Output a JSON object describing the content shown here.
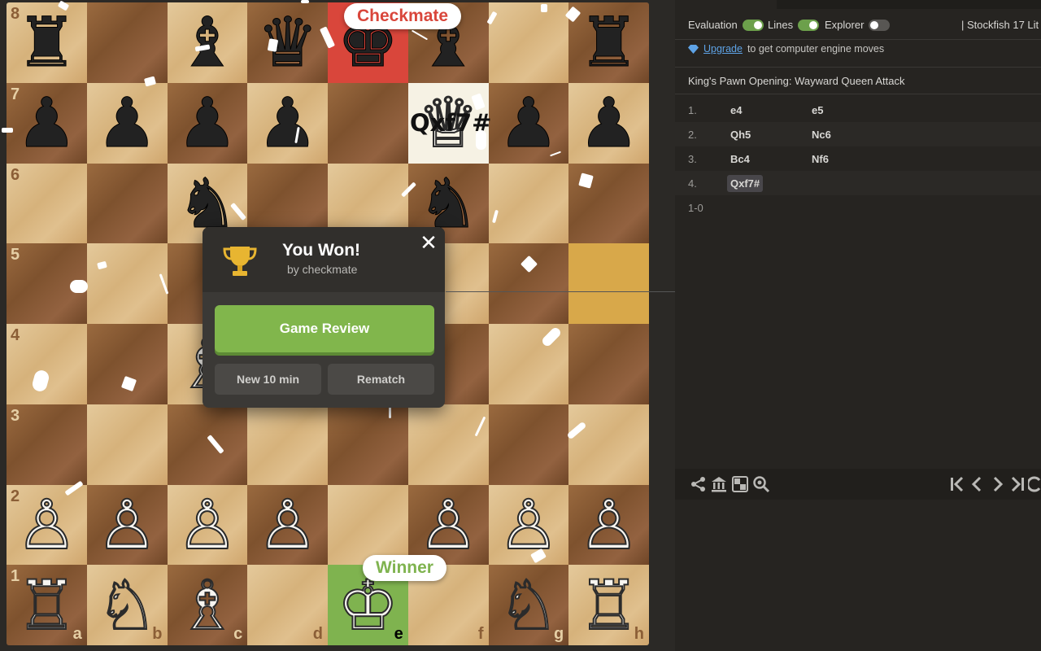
{
  "board": {
    "orientation": "white",
    "rows": [
      {
        "rank": "8",
        "squares": [
          {
            "file": "a",
            "piece": "♜",
            "color": "b",
            "shade": "light"
          },
          {
            "file": "b",
            "piece": "",
            "color": "",
            "shade": "dark"
          },
          {
            "file": "c",
            "piece": "♝",
            "color": "b",
            "shade": "light"
          },
          {
            "file": "d",
            "piece": "♛",
            "color": "b",
            "shade": "dark"
          },
          {
            "file": "e",
            "piece": "♚",
            "color": "b",
            "shade": "check"
          },
          {
            "file": "f",
            "piece": "♝",
            "color": "b",
            "shade": "dark"
          },
          {
            "file": "g",
            "piece": "",
            "color": "",
            "shade": "light"
          },
          {
            "file": "h",
            "piece": "♜",
            "color": "b",
            "shade": "dark"
          }
        ]
      },
      {
        "rank": "7",
        "squares": [
          {
            "file": "a",
            "piece": "♟",
            "color": "b",
            "shade": "dark"
          },
          {
            "file": "b",
            "piece": "♟",
            "color": "b",
            "shade": "light"
          },
          {
            "file": "c",
            "piece": "♟",
            "color": "b",
            "shade": "dark"
          },
          {
            "file": "d",
            "piece": "♟",
            "color": "b",
            "shade": "light"
          },
          {
            "file": "e",
            "piece": "",
            "color": "",
            "shade": "dark"
          },
          {
            "file": "f",
            "piece": "♕",
            "color": "w",
            "shade": "lastmove"
          },
          {
            "file": "g",
            "piece": "♟",
            "color": "b",
            "shade": "dark"
          },
          {
            "file": "h",
            "piece": "♟",
            "color": "b",
            "shade": "light"
          }
        ]
      },
      {
        "rank": "6",
        "squares": [
          {
            "file": "a",
            "piece": "",
            "color": "",
            "shade": "light"
          },
          {
            "file": "b",
            "piece": "",
            "color": "",
            "shade": "dark"
          },
          {
            "file": "c",
            "piece": "♞",
            "color": "b",
            "shade": "light"
          },
          {
            "file": "d",
            "piece": "",
            "color": "",
            "shade": "dark"
          },
          {
            "file": "e",
            "piece": "",
            "color": "",
            "shade": "light"
          },
          {
            "file": "f",
            "piece": "♞",
            "color": "b",
            "shade": "dark"
          },
          {
            "file": "g",
            "piece": "",
            "color": "",
            "shade": "light"
          },
          {
            "file": "h",
            "piece": "",
            "color": "",
            "shade": "dark"
          }
        ]
      },
      {
        "rank": "5",
        "squares": [
          {
            "file": "a",
            "piece": "",
            "color": "",
            "shade": "dark"
          },
          {
            "file": "b",
            "piece": "",
            "color": "",
            "shade": "light"
          },
          {
            "file": "c",
            "piece": "",
            "color": "",
            "shade": "dark"
          },
          {
            "file": "d",
            "piece": "",
            "color": "",
            "shade": "light"
          },
          {
            "file": "e",
            "piece": "♟",
            "color": "b",
            "shade": "dark"
          },
          {
            "file": "f",
            "piece": "",
            "color": "",
            "shade": "light"
          },
          {
            "file": "g",
            "piece": "",
            "color": "",
            "shade": "dark"
          },
          {
            "file": "h",
            "piece": "",
            "color": "",
            "shade": "highlight"
          }
        ]
      },
      {
        "rank": "4",
        "squares": [
          {
            "file": "a",
            "piece": "",
            "color": "",
            "shade": "light"
          },
          {
            "file": "b",
            "piece": "",
            "color": "",
            "shade": "dark"
          },
          {
            "file": "c",
            "piece": "♗",
            "color": "w",
            "shade": "light"
          },
          {
            "file": "d",
            "piece": "",
            "color": "",
            "shade": "dark"
          },
          {
            "file": "e",
            "piece": "♙",
            "color": "w",
            "shade": "light"
          },
          {
            "file": "f",
            "piece": "",
            "color": "",
            "shade": "dark"
          },
          {
            "file": "g",
            "piece": "",
            "color": "",
            "shade": "light"
          },
          {
            "file": "h",
            "piece": "",
            "color": "",
            "shade": "dark"
          }
        ]
      },
      {
        "rank": "3",
        "squares": [
          {
            "file": "a",
            "piece": "",
            "color": "",
            "shade": "dark"
          },
          {
            "file": "b",
            "piece": "",
            "color": "",
            "shade": "light"
          },
          {
            "file": "c",
            "piece": "",
            "color": "",
            "shade": "dark"
          },
          {
            "file": "d",
            "piece": "",
            "color": "",
            "shade": "light"
          },
          {
            "file": "e",
            "piece": "",
            "color": "",
            "shade": "dark"
          },
          {
            "file": "f",
            "piece": "",
            "color": "",
            "shade": "light"
          },
          {
            "file": "g",
            "piece": "",
            "color": "",
            "shade": "dark"
          },
          {
            "file": "h",
            "piece": "",
            "color": "",
            "shade": "light"
          }
        ]
      },
      {
        "rank": "2",
        "squares": [
          {
            "file": "a",
            "piece": "♙",
            "color": "w",
            "shade": "light"
          },
          {
            "file": "b",
            "piece": "♙",
            "color": "w",
            "shade": "dark"
          },
          {
            "file": "c",
            "piece": "♙",
            "color": "w",
            "shade": "light"
          },
          {
            "file": "d",
            "piece": "♙",
            "color": "w",
            "shade": "dark"
          },
          {
            "file": "e",
            "piece": "",
            "color": "",
            "shade": "light"
          },
          {
            "file": "f",
            "piece": "♙",
            "color": "w",
            "shade": "dark"
          },
          {
            "file": "g",
            "piece": "♙",
            "color": "w",
            "shade": "light"
          },
          {
            "file": "h",
            "piece": "♙",
            "color": "w",
            "shade": "dark"
          }
        ]
      },
      {
        "rank": "1",
        "squares": [
          {
            "file": "a",
            "piece": "♖",
            "color": "w",
            "shade": "dark"
          },
          {
            "file": "b",
            "piece": "♘",
            "color": "w",
            "shade": "light"
          },
          {
            "file": "c",
            "piece": "♗",
            "color": "w",
            "shade": "dark"
          },
          {
            "file": "d",
            "piece": "",
            "color": "",
            "shade": "light"
          },
          {
            "file": "e",
            "piece": "♔",
            "color": "w",
            "shade": "winner"
          },
          {
            "file": "f",
            "piece": "",
            "color": "",
            "shade": "light"
          },
          {
            "file": "g",
            "piece": "♘",
            "color": "w",
            "shade": "dark"
          },
          {
            "file": "h",
            "piece": "♖",
            "color": "w",
            "shade": "light"
          }
        ]
      }
    ],
    "checkmate_label": "Checkmate",
    "winner_label": "Winner",
    "last_move_label": "Qxf7#"
  },
  "modal": {
    "title": "You Won!",
    "subtitle": "by checkmate",
    "close_label": "✕",
    "review_label": "Game Review",
    "new_game_label": "New 10 min",
    "rematch_label": "Rematch"
  },
  "panel": {
    "toggles": [
      {
        "label": "Evaluation",
        "on": true
      },
      {
        "label": "Lines",
        "on": true
      },
      {
        "label": "Explorer",
        "on": false
      }
    ],
    "engine_name": "|  Stockfish 17 Lit",
    "upgrade_link": "Upgrade",
    "upgrade_text": "to get computer engine moves",
    "opening_name": "King's Pawn Opening: Wayward Queen Attack",
    "moves": [
      {
        "num": "1.",
        "white": "e4",
        "black": "e5"
      },
      {
        "num": "2.",
        "white": "Qh5",
        "black": "Nc6"
      },
      {
        "num": "3.",
        "white": "Bc4",
        "black": "Nf6"
      },
      {
        "num": "4.",
        "white": "Qxf7#",
        "black": ""
      }
    ],
    "result": "1-0"
  },
  "colors": {
    "accent_green": "#81b64c",
    "check_red": "#d9463b",
    "link_blue": "#5ea3e6"
  }
}
